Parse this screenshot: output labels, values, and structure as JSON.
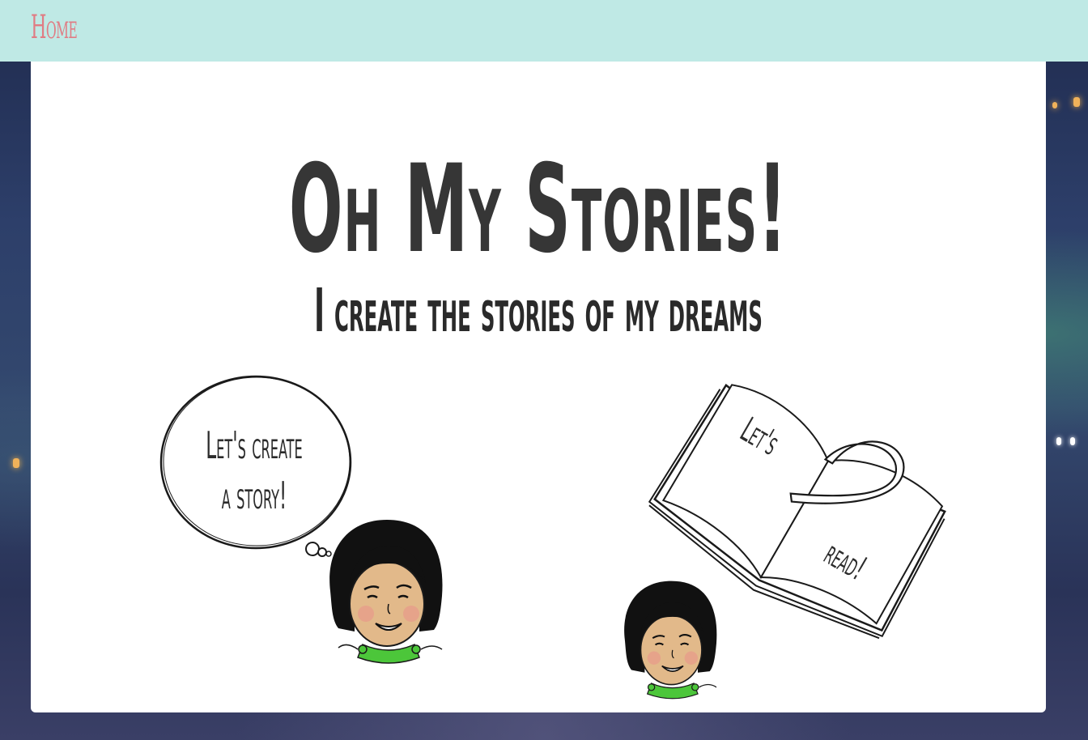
{
  "nav": {
    "home_label": "Home"
  },
  "hero": {
    "title": "Oh My Stories!",
    "subtitle": "I create the stories of my dreams"
  },
  "actions": {
    "create": {
      "bubble_line1": "Let's create",
      "bubble_line2": "a story!"
    },
    "read": {
      "book_left_page": "Let's",
      "book_right_page": "read!"
    }
  },
  "colors": {
    "nav_background": "#bfe9e5",
    "nav_link": "#e07c84",
    "heading": "#363636",
    "shirt": "#4cc63a",
    "skin": "#e2b98a",
    "cheek": "#e89a8a"
  },
  "icons": {
    "create": "thought-bubble-girl-icon",
    "read": "open-book-girl-icon"
  }
}
